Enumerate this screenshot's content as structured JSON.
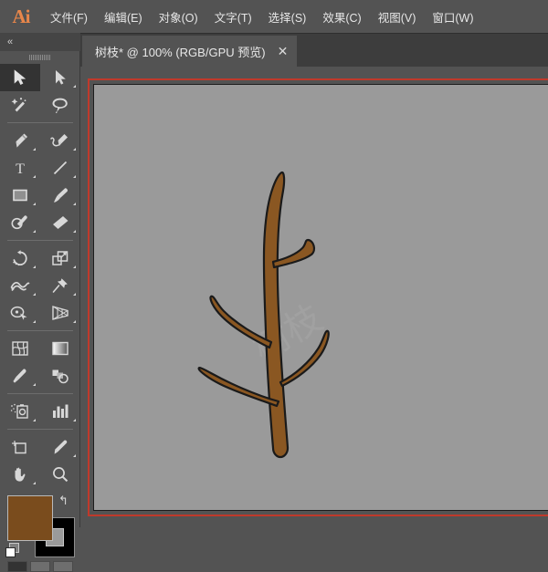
{
  "app": {
    "name": "Ai",
    "logo_color": "#e8864a"
  },
  "menubar": {
    "items": [
      {
        "label": "文件(F)",
        "name": "menu-file"
      },
      {
        "label": "编辑(E)",
        "name": "menu-edit"
      },
      {
        "label": "对象(O)",
        "name": "menu-object"
      },
      {
        "label": "文字(T)",
        "name": "menu-type"
      },
      {
        "label": "选择(S)",
        "name": "menu-select"
      },
      {
        "label": "效果(C)",
        "name": "menu-effect"
      },
      {
        "label": "视图(V)",
        "name": "menu-view"
      },
      {
        "label": "窗口(W)",
        "name": "menu-window"
      }
    ]
  },
  "tabbar": {
    "document": {
      "title": "树枝* @ 100% (RGB/GPU 预览)",
      "close_label": "✕",
      "modified": true,
      "zoom": "100%",
      "color_mode": "RGB",
      "preview_mode": "GPU 预览"
    }
  },
  "toolpanel": {
    "collapse_label": "«",
    "tools": [
      {
        "name": "selection-tool",
        "icon": "arrow-solid",
        "active": true,
        "corner": false
      },
      {
        "name": "direct-selection-tool",
        "icon": "arrow-outline",
        "active": false,
        "corner": true
      },
      {
        "name": "magic-wand-tool",
        "icon": "magic-wand",
        "active": false,
        "corner": false
      },
      {
        "name": "lasso-tool",
        "icon": "lasso",
        "active": false,
        "corner": false
      },
      {
        "name": "pen-tool",
        "icon": "pen",
        "active": false,
        "corner": true
      },
      {
        "name": "curvature-tool",
        "icon": "curvature-pen",
        "active": false,
        "corner": true
      },
      {
        "name": "type-tool",
        "icon": "type-t",
        "active": false,
        "corner": true
      },
      {
        "name": "line-segment-tool",
        "icon": "line-diagonal",
        "active": false,
        "corner": true
      },
      {
        "name": "rectangle-tool",
        "icon": "rectangle",
        "active": false,
        "corner": true
      },
      {
        "name": "paintbrush-tool",
        "icon": "paintbrush",
        "active": false,
        "corner": true
      },
      {
        "name": "blob-brush-tool",
        "icon": "blob-brush",
        "active": false,
        "corner": true
      },
      {
        "name": "eraser-tool",
        "icon": "eraser",
        "active": false,
        "corner": true
      },
      {
        "name": "rotate-tool",
        "icon": "rotate",
        "active": false,
        "corner": true
      },
      {
        "name": "scale-tool",
        "icon": "scale",
        "active": false,
        "corner": true
      },
      {
        "name": "width-tool",
        "icon": "width-warp",
        "active": false,
        "corner": true
      },
      {
        "name": "free-transform-tool",
        "icon": "pushpin",
        "active": false,
        "corner": true
      },
      {
        "name": "shape-builder-tool",
        "icon": "shape-builder",
        "active": false,
        "corner": true
      },
      {
        "name": "perspective-grid-tool",
        "icon": "perspective-grid",
        "active": false,
        "corner": true
      },
      {
        "name": "mesh-tool",
        "icon": "mesh",
        "active": false,
        "corner": false
      },
      {
        "name": "gradient-tool",
        "icon": "gradient",
        "active": false,
        "corner": false
      },
      {
        "name": "eyedropper-tool",
        "icon": "eyedropper",
        "active": false,
        "corner": true
      },
      {
        "name": "blend-tool",
        "icon": "blend",
        "active": false,
        "corner": false
      },
      {
        "name": "symbol-sprayer-tool",
        "icon": "symbol-sprayer",
        "active": false,
        "corner": true
      },
      {
        "name": "column-graph-tool",
        "icon": "bar-graph",
        "active": false,
        "corner": true
      },
      {
        "name": "artboard-tool",
        "icon": "artboard",
        "active": false,
        "corner": false
      },
      {
        "name": "slice-tool",
        "icon": "slice-knife",
        "active": false,
        "corner": true
      },
      {
        "name": "hand-tool",
        "icon": "hand",
        "active": false,
        "corner": true
      },
      {
        "name": "zoom-tool",
        "icon": "magnifier",
        "active": false,
        "corner": false
      }
    ],
    "fill_color": "#7a4c1d",
    "stroke_color": "#000000",
    "swap_icon": "↰",
    "draw_modes": [
      "normal-draw",
      "draw-behind",
      "draw-inside"
    ]
  },
  "canvas": {
    "selection_border_color": "#c0392b",
    "artboard_bg": "#9a9a9a",
    "artboard_edge_color": "#1d1d1d",
    "artwork": {
      "name": "tree-branch-illustration",
      "branch_fill": "#8a5722",
      "branch_stroke": "#1a1a1a",
      "description": "树枝"
    },
    "watermark": "树枝"
  }
}
